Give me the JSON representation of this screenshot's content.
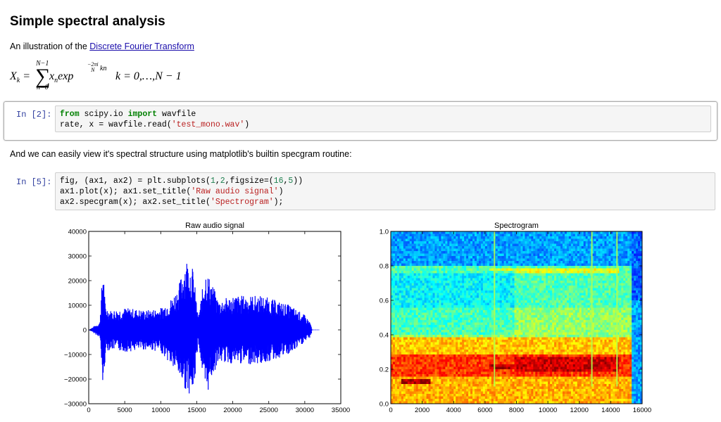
{
  "page": {
    "title": "Simple spectral analysis",
    "intro_prefix": "An illustration of the ",
    "intro_link": "Discrete Fourier Transform",
    "equation": {
      "lhs": "X",
      "lhs_sub": "k",
      "sum_top": "N−1",
      "sum_bottom": "n=0",
      "body": "x",
      "body_sub": "n",
      "exp_word": "exp",
      "exp_power": "kn",
      "exp_num": "−2πi",
      "exp_den": "N",
      "range": "k = 0,…,N − 1"
    },
    "text2": "And we can easily view it's spectral structure using matplotlib's builtin specgram routine:"
  },
  "cells": [
    {
      "prompt": "In [2]:",
      "lines": [
        [
          [
            "kw",
            "from"
          ],
          [
            "t",
            " scipy.io "
          ],
          [
            "kw",
            "import"
          ],
          [
            "t",
            " wavfile"
          ]
        ],
        [
          [
            "t",
            "rate, x = wavfile.read("
          ],
          [
            "str",
            "'test_mono.wav'"
          ],
          [
            "t",
            ")"
          ]
        ]
      ]
    },
    {
      "prompt": "In [5]:",
      "lines": [
        [
          [
            "t",
            "fig, (ax1, ax2) = plt.subplots("
          ],
          [
            "num",
            "1"
          ],
          [
            "t",
            ","
          ],
          [
            "num",
            "2"
          ],
          [
            "t",
            ",figsize=("
          ],
          [
            "num",
            "16"
          ],
          [
            "t",
            ","
          ],
          [
            "num",
            "5"
          ],
          [
            "t",
            "))"
          ]
        ],
        [
          [
            "t",
            "ax1.plot(x); ax1.set_title("
          ],
          [
            "str",
            "'Raw audio signal'"
          ],
          [
            "t",
            ")"
          ]
        ],
        [
          [
            "t",
            "ax2.specgram(x); ax2.set_title("
          ],
          [
            "str",
            "'Spectrogram'"
          ],
          [
            "t",
            ");"
          ]
        ]
      ]
    }
  ],
  "chart_data": [
    {
      "type": "line",
      "title": "Raw audio signal",
      "xlim": [
        0,
        35000
      ],
      "ylim": [
        -30000,
        40000
      ],
      "xticks": [
        "0",
        "5000",
        "10000",
        "15000",
        "20000",
        "25000",
        "30000",
        "35000"
      ],
      "yticks": [
        "40000",
        "30000",
        "20000",
        "10000",
        "0",
        "−10000",
        "−20000",
        "−30000"
      ],
      "series": [
        {
          "color": "#0000ff",
          "envelope_x": [
            0,
            1500,
            2000,
            2300,
            3000,
            5000,
            8000,
            10000,
            11500,
            12500,
            13500,
            14500,
            15200,
            16200,
            17000,
            18000,
            20000,
            24000,
            28000,
            30000,
            30800,
            31000,
            32000
          ],
          "envelope_max": [
            0,
            3000,
            27000,
            10000,
            8000,
            9000,
            8000,
            9000,
            13000,
            18000,
            30000,
            25000,
            5000,
            25000,
            20000,
            12000,
            14000,
            14000,
            10000,
            6000,
            3000,
            0,
            0
          ],
          "envelope_min": [
            0,
            -3000,
            -26000,
            -9000,
            -8000,
            -9000,
            -8000,
            -9000,
            -15000,
            -19000,
            -25000,
            -27000,
            -5000,
            -29000,
            -20000,
            -13000,
            -14000,
            -14000,
            -10000,
            -5000,
            -3000,
            0,
            0
          ]
        }
      ]
    },
    {
      "type": "heatmap",
      "title": "Spectrogram",
      "xlim": [
        0,
        16000
      ],
      "ylim": [
        0,
        1.0
      ],
      "xticks": [
        "0",
        "2000",
        "4000",
        "6000",
        "8000",
        "10000",
        "12000",
        "14000",
        "16000"
      ],
      "yticks": [
        "1.0",
        "0.8",
        "0.6",
        "0.4",
        "0.2",
        "0.0"
      ],
      "colormap": "jet",
      "bands": [
        {
          "y": [
            0.8,
            1.0
          ],
          "level": 0.28
        },
        {
          "y": [
            0.55,
            0.8
          ],
          "level": 0.45
        },
        {
          "y": [
            0.38,
            0.55
          ],
          "level": 0.52
        },
        {
          "y": [
            0.28,
            0.38
          ],
          "level": 0.68
        },
        {
          "y": [
            0.16,
            0.28
          ],
          "level": 0.82
        },
        {
          "y": [
            0.0,
            0.16
          ],
          "level": 0.7
        }
      ],
      "features": [
        {
          "x": [
            6300,
            7900
          ],
          "y": [
            0.77,
            0.79
          ],
          "level": 0.6
        },
        {
          "x": [
            7900,
            14500
          ],
          "y": [
            0.76,
            0.78
          ],
          "level": 0.6
        },
        {
          "x": [
            7900,
            14500
          ],
          "y": [
            0.19,
            0.27
          ],
          "level": 0.92
        },
        {
          "x": [
            6300,
            7900
          ],
          "y": [
            0.2,
            0.23
          ],
          "level": 0.95
        },
        {
          "x": [
            700,
            2500
          ],
          "y": [
            0.11,
            0.14
          ],
          "level": 0.96
        }
      ]
    }
  ]
}
